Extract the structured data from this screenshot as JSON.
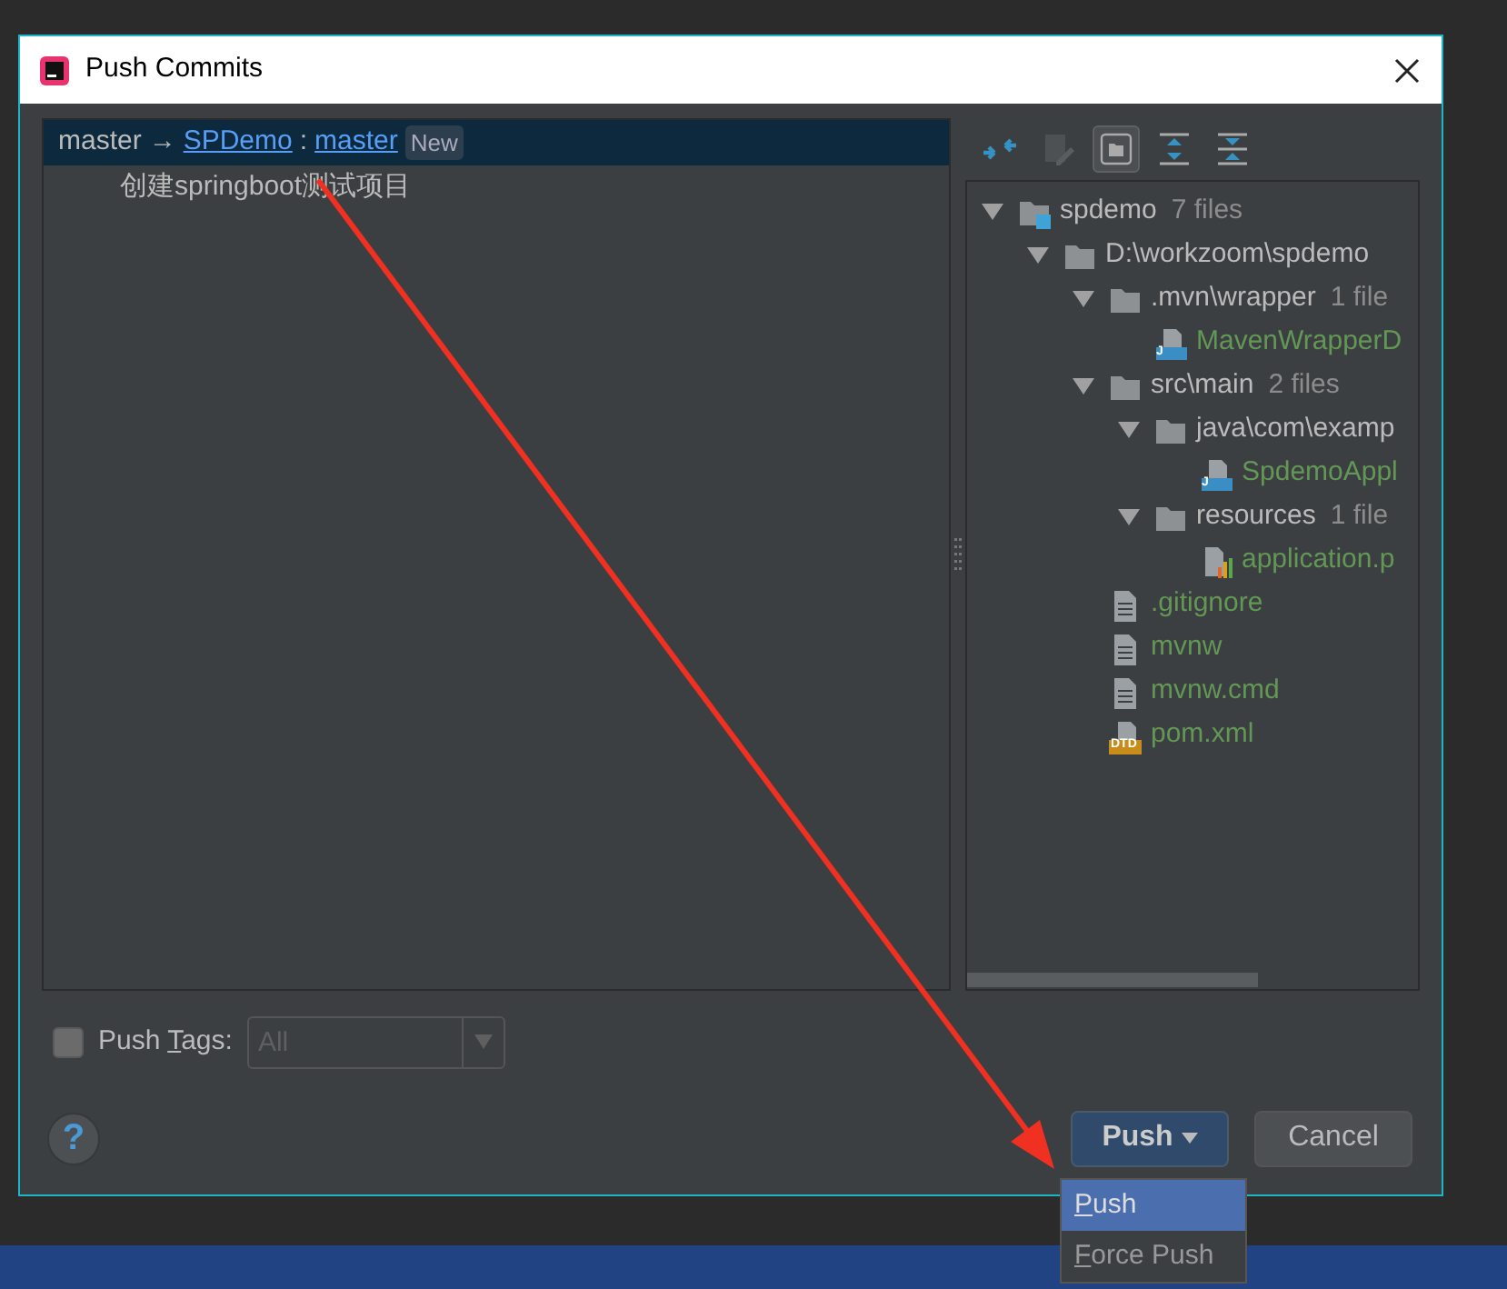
{
  "window": {
    "title": "Push Commits"
  },
  "commits_panel": {
    "branch": {
      "source": "master",
      "arrow": "→",
      "remote": "SPDemo",
      "separator": ":",
      "target": "master",
      "badge": "New",
      "selected": true
    },
    "commits": [
      {
        "message": "创建springboot测试项目"
      }
    ]
  },
  "toolbar": [
    {
      "kind": "collapse",
      "selected": false,
      "disabled": false
    },
    {
      "kind": "edit",
      "selected": false,
      "disabled": true
    },
    {
      "kind": "group",
      "selected": true,
      "disabled": false
    },
    {
      "kind": "expand-all",
      "selected": false,
      "disabled": false
    },
    {
      "kind": "collapse-all",
      "selected": false,
      "disabled": false
    }
  ],
  "tree": [
    {
      "label": "spdemo",
      "count": "7 files",
      "kind": "module",
      "expanded": true,
      "children": [
        {
          "label": "D:\\workzoom\\spdemo",
          "kind": "folder",
          "expanded": true,
          "children": [
            {
              "label": ".mvn\\wrapper",
              "count": "1 file",
              "kind": "folder",
              "expanded": true,
              "children": [
                {
                  "label": "MavenWrapperD",
                  "kind": "java",
                  "badge": "J"
                }
              ]
            },
            {
              "label": "src\\main",
              "count": "2 files",
              "kind": "folder",
              "expanded": true,
              "children": [
                {
                  "label": "java\\com\\examp",
                  "kind": "folder",
                  "expanded": true,
                  "children": [
                    {
                      "label": "SpdemoAppl",
                      "kind": "java",
                      "badge": "J"
                    }
                  ]
                },
                {
                  "label": "resources",
                  "count": "1 file",
                  "kind": "folder",
                  "expanded": true,
                  "children": [
                    {
                      "label": "application.p",
                      "kind": "properties"
                    }
                  ]
                }
              ]
            },
            {
              "label": ".gitignore",
              "kind": "text"
            },
            {
              "label": "mvnw",
              "kind": "text"
            },
            {
              "label": "mvnw.cmd",
              "kind": "text"
            },
            {
              "label": "pom.xml",
              "kind": "xml",
              "badge": "DTD"
            }
          ]
        }
      ]
    }
  ],
  "push_tags": {
    "before": "Push ",
    "mnemonic": "T",
    "after": "ags:",
    "checked": false,
    "combo": {
      "value": "All",
      "disabled": true
    }
  },
  "help": {
    "label": "?"
  },
  "buttons": [
    {
      "label": "Push",
      "kind": "split",
      "default": true
    },
    {
      "label": "Cancel",
      "kind": "plain",
      "default": false
    }
  ],
  "menu": [
    {
      "mnemonic": "P",
      "rest": "ush",
      "selected": true
    },
    {
      "mnemonic": "F",
      "rest": "orce Push",
      "selected": false
    }
  ]
}
